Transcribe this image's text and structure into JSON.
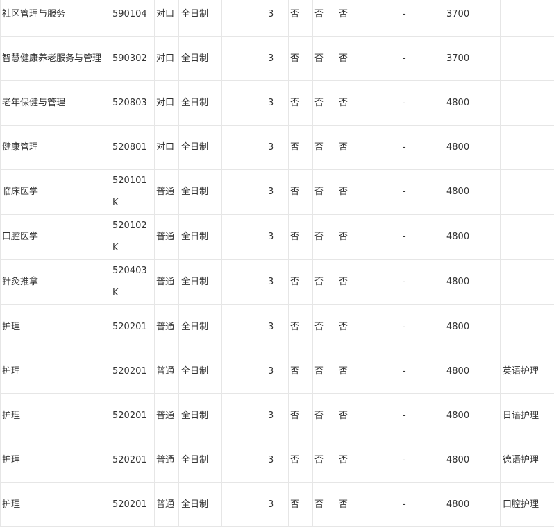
{
  "table": {
    "rows": [
      {
        "major": "社区管理与服务",
        "code": "590104",
        "type": "对口",
        "form": "全日制",
        "extra": "",
        "years": "3",
        "flag1": "否",
        "flag2": "否",
        "flag3": "否",
        "note": "-",
        "fee": "3700",
        "direction": ""
      },
      {
        "major": "智慧健康养老服务与管理",
        "code": "590302",
        "type": "对口",
        "form": "全日制",
        "extra": "",
        "years": "3",
        "flag1": "否",
        "flag2": "否",
        "flag3": "否",
        "note": "-",
        "fee": "3700",
        "direction": ""
      },
      {
        "major": "老年保健与管理",
        "code": "520803",
        "type": "对口",
        "form": "全日制",
        "extra": "",
        "years": "3",
        "flag1": "否",
        "flag2": "否",
        "flag3": "否",
        "note": "-",
        "fee": "4800",
        "direction": ""
      },
      {
        "major": "健康管理",
        "code": "520801",
        "type": "对口",
        "form": "全日制",
        "extra": "",
        "years": "3",
        "flag1": "否",
        "flag2": "否",
        "flag3": "否",
        "note": "-",
        "fee": "4800",
        "direction": ""
      },
      {
        "major": "临床医学",
        "code": "520101K",
        "type": "普通",
        "form": "全日制",
        "extra": "",
        "years": "3",
        "flag1": "否",
        "flag2": "否",
        "flag3": "否",
        "note": "-",
        "fee": "4800",
        "direction": ""
      },
      {
        "major": "口腔医学",
        "code": "520102K",
        "type": "普通",
        "form": "全日制",
        "extra": "",
        "years": "3",
        "flag1": "否",
        "flag2": "否",
        "flag3": "否",
        "note": "-",
        "fee": "4800",
        "direction": ""
      },
      {
        "major": "针灸推拿",
        "code": "520403K",
        "type": "普通",
        "form": "全日制",
        "extra": "",
        "years": "3",
        "flag1": "否",
        "flag2": "否",
        "flag3": "否",
        "note": "-",
        "fee": "4800",
        "direction": ""
      },
      {
        "major": "护理",
        "code": "520201",
        "type": "普通",
        "form": "全日制",
        "extra": "",
        "years": "3",
        "flag1": "否",
        "flag2": "否",
        "flag3": "否",
        "note": "-",
        "fee": "4800",
        "direction": ""
      },
      {
        "major": "护理",
        "code": "520201",
        "type": "普通",
        "form": "全日制",
        "extra": "",
        "years": "3",
        "flag1": "否",
        "flag2": "否",
        "flag3": "否",
        "note": "-",
        "fee": "4800",
        "direction": "英语护理"
      },
      {
        "major": "护理",
        "code": "520201",
        "type": "普通",
        "form": "全日制",
        "extra": "",
        "years": "3",
        "flag1": "否",
        "flag2": "否",
        "flag3": "否",
        "note": "-",
        "fee": "4800",
        "direction": "日语护理"
      },
      {
        "major": "护理",
        "code": "520201",
        "type": "普通",
        "form": "全日制",
        "extra": "",
        "years": "3",
        "flag1": "否",
        "flag2": "否",
        "flag3": "否",
        "note": "-",
        "fee": "4800",
        "direction": "德语护理"
      },
      {
        "major": "护理",
        "code": "520201",
        "type": "普通",
        "form": "全日制",
        "extra": "",
        "years": "3",
        "flag1": "否",
        "flag2": "否",
        "flag3": "否",
        "note": "-",
        "fee": "4800",
        "direction": "口腔护理"
      }
    ]
  }
}
